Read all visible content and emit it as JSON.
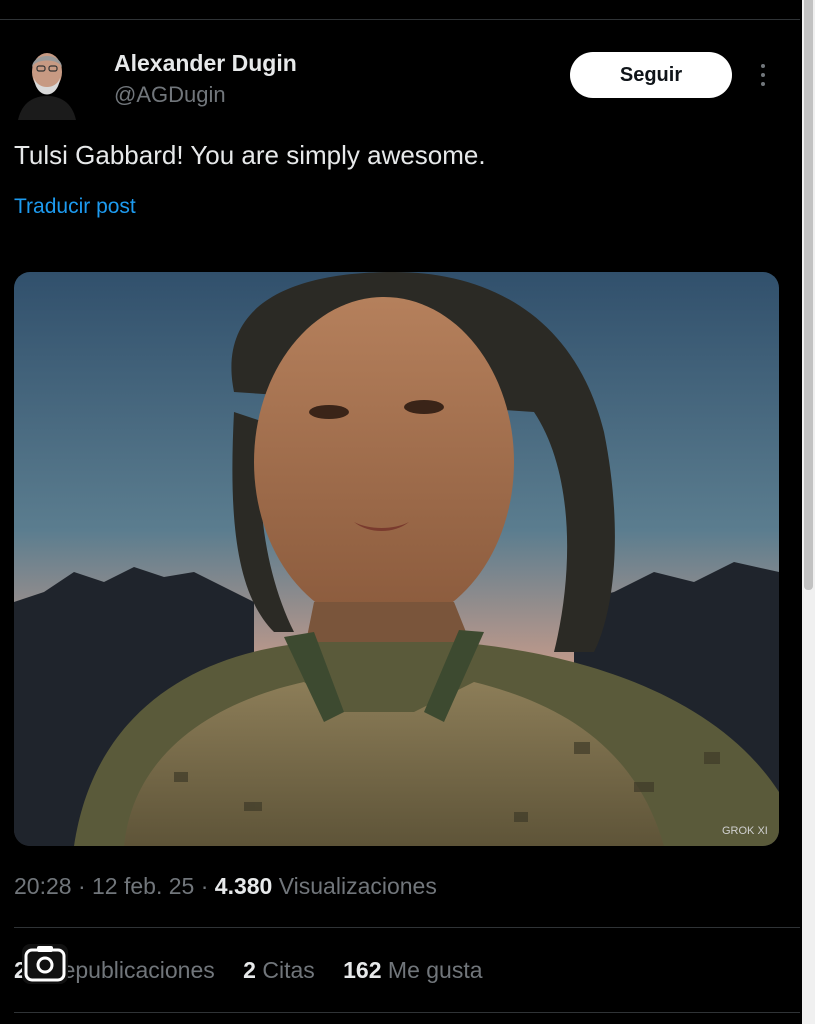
{
  "author": {
    "display_name": "Alexander Dugin",
    "handle": "@AGDugin",
    "avatar_icon": "user-avatar"
  },
  "follow_label": "Seguir",
  "more_icon": "more-vertical-icon",
  "post": {
    "text": "Tulsi Gabbard! You are simply awesome.",
    "translate_label": "Traducir post"
  },
  "media": {
    "watermark": "GROK XI",
    "kind": "photo"
  },
  "meta": {
    "time": "20:28",
    "date": "12 feb. 25",
    "views_count": "4.380",
    "views_label": "Visualizaciones"
  },
  "stats": {
    "reposts_count": "21",
    "reposts_label": "Republicaciones",
    "quotes_count": "2",
    "quotes_label": "Citas",
    "likes_count": "162",
    "likes_label": "Me gusta"
  },
  "colors": {
    "background": "#000000",
    "text": "#e7e9ea",
    "secondary": "#71767b",
    "link": "#1d9bf0",
    "follow_bg": "#ffffff"
  }
}
